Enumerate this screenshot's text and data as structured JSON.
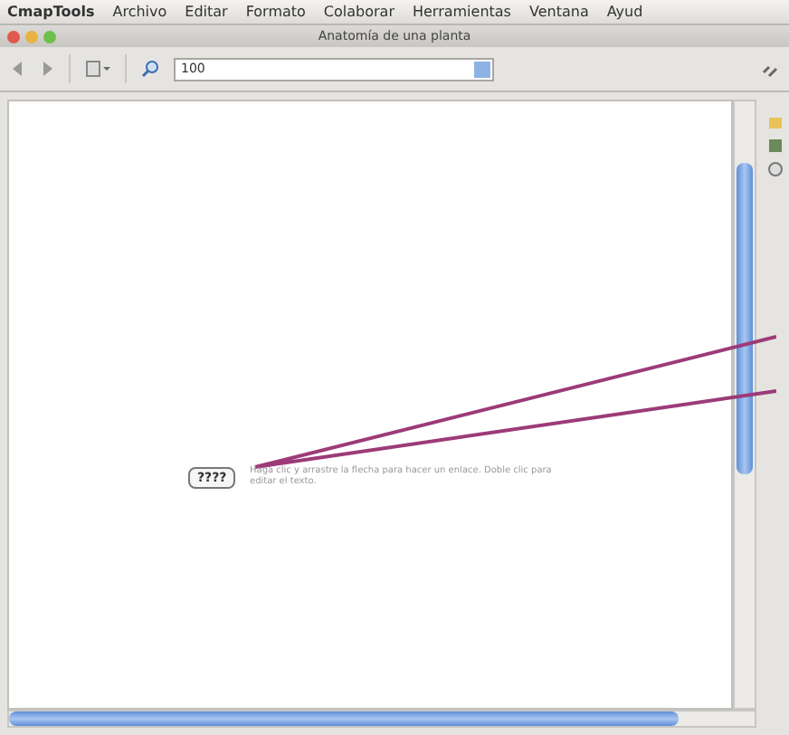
{
  "menu_bar": [
    "CmapTools",
    "Archivo",
    "Editar",
    "Formato",
    "Colaborar",
    "Herramientas",
    "Ventana",
    "Ayud"
  ],
  "window": {
    "title": "Anatomía de una planta"
  },
  "toolbar": {
    "zoom": "100"
  },
  "canvas": {
    "concept": "????",
    "hint": "Haga clic y arrastre la flecha para hacer un enlace. Doble clic para editar el texto."
  }
}
